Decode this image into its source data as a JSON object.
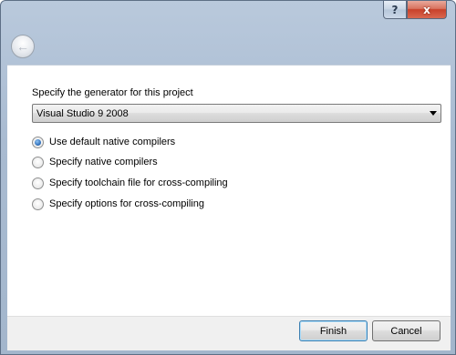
{
  "titlebar": {
    "help_label": "?",
    "close_label": "x"
  },
  "navigation": {
    "back_icon": "back-arrow-icon",
    "back_glyph": "←"
  },
  "generator": {
    "label": "Specify the generator for this project",
    "selected": "Visual Studio 9 2008"
  },
  "compiler_options": [
    {
      "label": "Use default native compilers",
      "checked": true
    },
    {
      "label": "Specify native compilers",
      "checked": false
    },
    {
      "label": "Specify toolchain file for cross-compiling",
      "checked": false
    },
    {
      "label": "Specify options for cross-compiling",
      "checked": false
    }
  ],
  "buttons": {
    "finish": "Finish",
    "cancel": "Cancel"
  }
}
